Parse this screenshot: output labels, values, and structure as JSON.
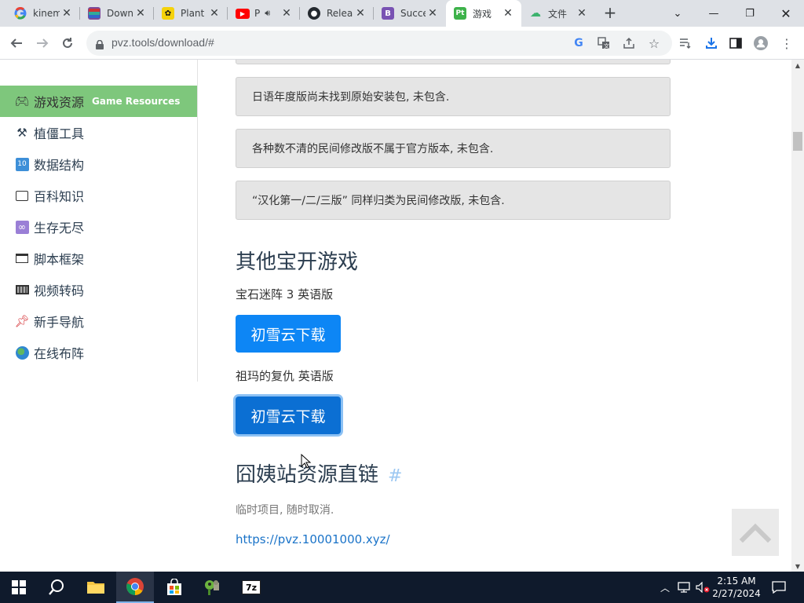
{
  "browser": {
    "tabs": [
      {
        "title": "kinem",
        "icon": "google-icon"
      },
      {
        "title": "Down",
        "icon": "winrar-icon"
      },
      {
        "title": "Plant",
        "icon": "plant-icon"
      },
      {
        "title": "P",
        "icon": "youtube-icon"
      },
      {
        "title": "Relea",
        "icon": "github-icon"
      },
      {
        "title": "Succe",
        "icon": "bootstrap-icon"
      },
      {
        "title": "游戏",
        "icon": "pvz-tools-icon"
      },
      {
        "title": "文件",
        "icon": "cloud-icon"
      }
    ],
    "url": "pvz.tools/download/#"
  },
  "sidebar": {
    "items": [
      {
        "label": "游戏资源",
        "sub": "Game Resources",
        "icon": "gamepad-icon"
      },
      {
        "label": "植僵工具",
        "icon": "tools-icon"
      },
      {
        "label": "数据结构",
        "icon": "number-ten-icon"
      },
      {
        "label": "百科知识",
        "icon": "book-icon"
      },
      {
        "label": "生存无尽",
        "icon": "infinity-icon"
      },
      {
        "label": "脚本框架",
        "icon": "window-icon"
      },
      {
        "label": "视频转码",
        "icon": "keyboard-icon"
      },
      {
        "label": "新手导航",
        "icon": "pin-icon"
      },
      {
        "label": "在线布阵",
        "icon": "globe-icon"
      }
    ]
  },
  "content": {
    "notices": [
      "日语年度版尚未找到原始安装包, 未包含.",
      "各种数不清的民间修改版不属于官方版本, 未包含.",
      "“汉化第一/二/三版” 同样归类为民间修改版, 未包含."
    ],
    "section1": {
      "heading": "其他宝开游戏",
      "items": [
        {
          "name": "宝石迷阵 3 英语版",
          "button": "初雪云下载"
        },
        {
          "name": "祖玛的复仇 英语版",
          "button": "初雪云下载"
        }
      ]
    },
    "section2": {
      "heading": "囧姨站资源直链",
      "anchor": "#",
      "note": "临时项目, 随时取消.",
      "link": "https://pvz.10001000.xyz/"
    }
  },
  "taskbar": {
    "time": "2:15 AM",
    "date": "2/27/2024"
  }
}
